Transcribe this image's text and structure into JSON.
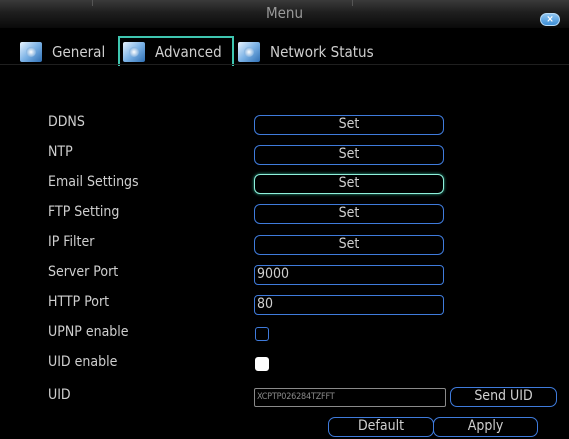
{
  "window": {
    "title": "Menu",
    "close_symbol": "×"
  },
  "tabs": [
    {
      "label": "General",
      "icon": "settings-app-icon"
    },
    {
      "label": "Advanced",
      "icon": "settings-app-icon"
    },
    {
      "label": "Network Status",
      "icon": "settings-app-icon"
    }
  ],
  "rows": {
    "ddns": {
      "label": "DDNS",
      "button": "Set"
    },
    "ntp": {
      "label": "NTP",
      "button": "Set"
    },
    "email": {
      "label": "Email Settings",
      "button": "Set"
    },
    "ftp": {
      "label": "FTP Setting",
      "button": "Set"
    },
    "ipfilter": {
      "label": "IP Filter",
      "button": "Set"
    },
    "server_port": {
      "label": "Server Port",
      "value": "9000"
    },
    "http_port": {
      "label": "HTTP Port",
      "value": "80"
    },
    "upnp": {
      "label": "UPNP enable",
      "checked": false
    },
    "uid_enable": {
      "label": "UID enable",
      "checked": true
    },
    "uid": {
      "label": "UID",
      "value": "XCPTP026284TZFFT",
      "button": "Send UID"
    }
  },
  "footer": {
    "default_label": "Default",
    "apply_label": "Apply"
  },
  "colors": {
    "accent": "#3f7bdc",
    "focus": "#8ff0dc",
    "active_tab": "#3fc6b0"
  }
}
